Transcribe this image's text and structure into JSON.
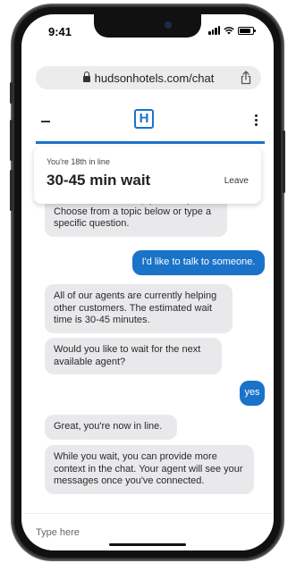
{
  "status_bar": {
    "time": "9:41"
  },
  "browser": {
    "url": "hudsonhotels.com/chat"
  },
  "header": {
    "logo_letter": "H"
  },
  "queue": {
    "position_text": "You're 18th in line",
    "wait_text": "30-45 min wait",
    "leave_label": "Leave",
    "progress": 1.0
  },
  "messages": [
    {
      "from": "bot",
      "text": "Hello! How can I help you today? Choose from a topic below or type a specific question."
    },
    {
      "from": "user",
      "text": "I'd like to talk to someone."
    },
    {
      "from": "bot",
      "text": "All of our agents are currently helping other customers. The estimated wait time is 30-45 minutes."
    },
    {
      "from": "bot",
      "text": "Would you like to wait for the next available agent?"
    },
    {
      "from": "user",
      "text": "yes"
    },
    {
      "from": "bot",
      "text": "Great, you're now in line."
    },
    {
      "from": "bot",
      "text": "While you wait, you can provide more context in the chat. Your agent will see your messages once you've connected."
    }
  ],
  "composer": {
    "placeholder": "Type here"
  },
  "colors": {
    "accent": "#1a73c8",
    "bot_bubble": "#e9e9ec"
  }
}
